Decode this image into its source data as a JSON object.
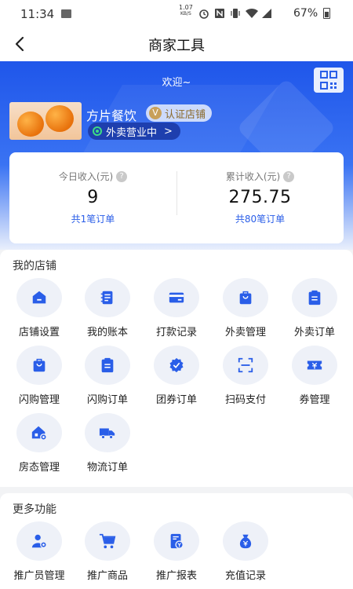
{
  "status_bar": {
    "time": "11:34",
    "net_speed_value": "1.07",
    "net_speed_unit": "KB/S",
    "battery_percent": "67%"
  },
  "nav": {
    "title": "商家工具"
  },
  "hero": {
    "welcome": "欢迎~",
    "store_name": "方片餐饮",
    "cert_label": "认证店铺",
    "status_label": "外卖营业中",
    "status_chevron": ">"
  },
  "income": {
    "today_label": "今日收入(元)",
    "today_value": "9",
    "today_orders": "共1笔订单",
    "total_label": "累计收入(元)",
    "total_value": "275.75",
    "total_orders": "共80笔订单",
    "help_mark": "?"
  },
  "my_store": {
    "title": "我的店铺",
    "items": [
      {
        "label": "店铺设置",
        "icon": "store-icon"
      },
      {
        "label": "我的账本",
        "icon": "ledger-icon"
      },
      {
        "label": "打款记录",
        "icon": "card-icon"
      },
      {
        "label": "外卖管理",
        "icon": "bag-icon"
      },
      {
        "label": "外卖订单",
        "icon": "clipboard-icon"
      },
      {
        "label": "闪购管理",
        "icon": "bag-icon"
      },
      {
        "label": "闪购订单",
        "icon": "clipboard-icon"
      },
      {
        "label": "团券订单",
        "icon": "badge-check-icon"
      },
      {
        "label": "扫码支付",
        "icon": "scan-icon"
      },
      {
        "label": "券管理",
        "icon": "coupon-icon"
      },
      {
        "label": "房态管理",
        "icon": "house-gear-icon"
      },
      {
        "label": "物流订单",
        "icon": "truck-icon"
      }
    ]
  },
  "more": {
    "title": "更多功能",
    "items": [
      {
        "label": "推广员管理",
        "icon": "user-gear-icon"
      },
      {
        "label": "推广商品",
        "icon": "cart-icon"
      },
      {
        "label": "推广报表",
        "icon": "report-icon"
      },
      {
        "label": "充值记录",
        "icon": "money-bag-icon"
      }
    ]
  },
  "colors": {
    "accent": "#2a5ee8",
    "hero_top": "#1f56ea",
    "icon_circle": "#eef1f8",
    "status_dot": "#3ddc84"
  }
}
